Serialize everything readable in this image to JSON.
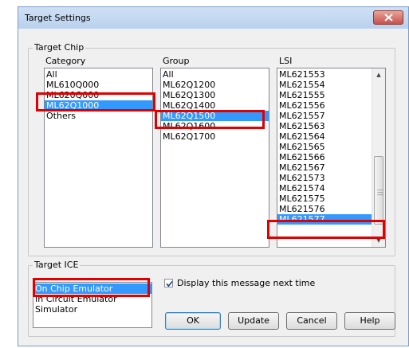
{
  "window": {
    "title": "Target Settings"
  },
  "target_chip": {
    "legend": "Target Chip",
    "category": {
      "label": "Category",
      "items": [
        "All",
        "ML610Q000",
        "ML620Q000",
        "ML62Q1000",
        "Others"
      ],
      "selected": "ML62Q1000"
    },
    "group": {
      "label": "Group",
      "items": [
        "All",
        "ML62Q1200",
        "ML62Q1300",
        "ML62Q1400",
        "ML62Q1500",
        "ML62Q1600",
        "ML62Q1700"
      ],
      "selected": "ML62Q1500"
    },
    "lsi": {
      "label": "LSI",
      "items": [
        "ML621553",
        "ML621554",
        "ML621555",
        "ML621556",
        "ML621557",
        "ML621563",
        "ML621564",
        "ML621565",
        "ML621566",
        "ML621567",
        "ML621573",
        "ML621574",
        "ML621575",
        "ML621576",
        "ML621577"
      ],
      "selected": "ML621577"
    }
  },
  "target_ice": {
    "legend": "Target ICE",
    "items": [
      "On Chip Emulator",
      "In Circuit Emulator",
      "Simulator"
    ],
    "selected": "On Chip Emulator"
  },
  "display_message": {
    "label": "Display this message next time",
    "checked": true
  },
  "buttons": {
    "ok": "OK",
    "update": "Update",
    "cancel": "Cancel",
    "help": "Help"
  },
  "icons": {
    "close": "close-x-icon",
    "check": "checkmark-icon",
    "scroll_up": "arrow-up-icon",
    "scroll_down": "arrow-down-icon"
  },
  "colors": {
    "selection": "#3399ff",
    "highlight": "#e00000",
    "close_button": "#c75050"
  }
}
